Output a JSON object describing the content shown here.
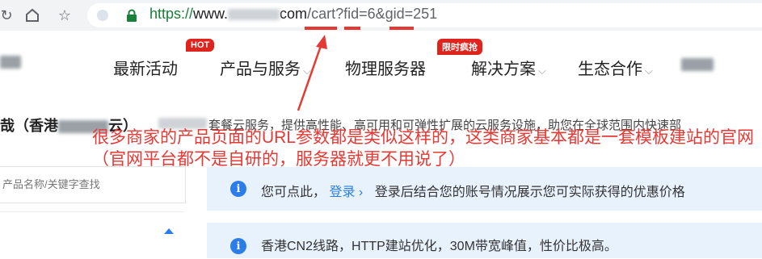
{
  "browser": {
    "url_scheme": "https://",
    "url_host_prefix": "www.",
    "url_host_suffix": "com",
    "url_path": "/cart?fid=6&gid=251"
  },
  "nav": {
    "items": [
      {
        "label": "最新活动"
      },
      {
        "label": "产品与服务",
        "badge": "HOT"
      },
      {
        "label": "物理服务器"
      },
      {
        "label": "解决方案",
        "badge": "限时疯抢"
      },
      {
        "label": "生态合作"
      }
    ]
  },
  "page": {
    "left_title": "哉（香港",
    "left_title_tail": "云）",
    "desc": "套餐云服务，提供高性能、高可用和可弹性扩展的云服务设施，助您在全球范围内快速部"
  },
  "annotation": {
    "text": "很多商家的产品页面的URL参数都是类似这样的，这类商家基本都是一套模板建站的官网（官网平台都不是自研的，服务器就更不用说了）"
  },
  "sidebar": {
    "search_placeholder": "产品名称/关键字查找"
  },
  "notices": {
    "login_prefix": "您可点此，",
    "login_link": "登录 ›",
    "login_suffix": "登录后结合您的账号情况展示您可实际获得的优惠价格",
    "feature_line": "香港CN2线路，HTTP建站优化，30M带宽峰值，性价比极高。"
  },
  "colors": {
    "accent": "#2b7de9",
    "annotation": "#e53935",
    "url_green": "#188038"
  }
}
